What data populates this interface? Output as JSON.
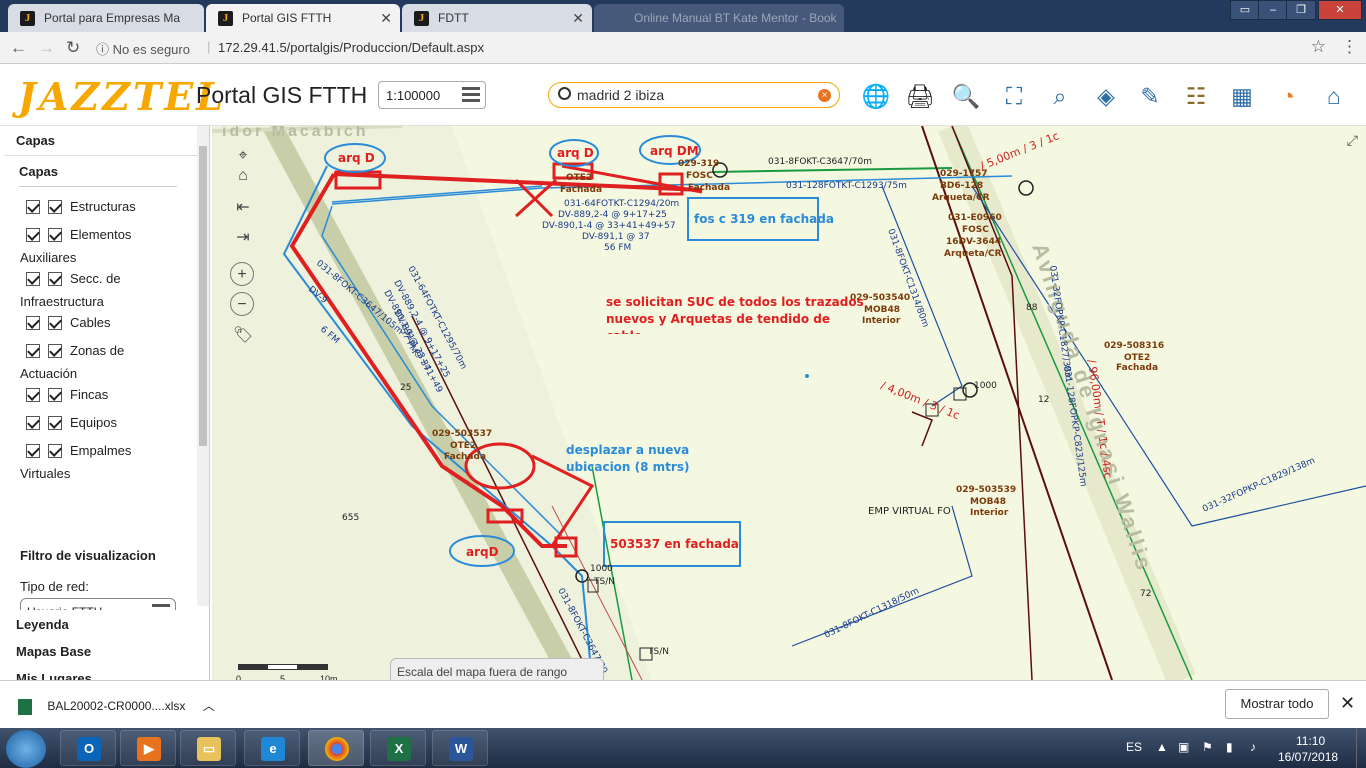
{
  "browser": {
    "tabs": [
      {
        "title": "Portal para Empresas Ma",
        "favicon": "J"
      },
      {
        "title": "Portal GIS FTTH",
        "favicon": "J"
      },
      {
        "title": "FDTT",
        "favicon": "J"
      },
      {
        "title": "Online Manual BT Kate Mentor - Book",
        "favicon": ""
      }
    ],
    "security": "No es seguro",
    "url": "172.29.41.5/portalgis/Produccion/Default.aspx"
  },
  "header": {
    "logo_text": "JAZZTEL",
    "title": "Portal GIS FTTH",
    "scale": "1:100000",
    "search_value": "madrid 2 ibiza",
    "tool_icons": [
      "globe-icon",
      "printer-icon",
      "magnifier-icon",
      "measure-icon",
      "route-search-icon",
      "layers-query-icon",
      "edit-icon",
      "legend-icon",
      "grid-icon",
      "wifi-icon",
      "home-icon"
    ]
  },
  "panel": {
    "layers_header": "Capas",
    "layers_sub": "Capas",
    "layers": [
      {
        "label": "Estructuras",
        "cont": ""
      },
      {
        "label": "Elementos",
        "cont": "Auxiliares"
      },
      {
        "label": "Secc. de",
        "cont": "Infraestructura"
      },
      {
        "label": "Cables",
        "cont": ""
      },
      {
        "label": "Zonas de",
        "cont": "Actuación"
      },
      {
        "label": "Fincas",
        "cont": ""
      },
      {
        "label": "Equipos",
        "cont": ""
      },
      {
        "label": "Empalmes",
        "cont": "Virtuales"
      }
    ],
    "filter_title": "Filtro de visualizacion",
    "net_type_label": "Tipo de red:",
    "net_type_value": "Usuario FTTH",
    "sections": [
      "Leyenda",
      "Mapas Base",
      "Mis Lugares"
    ]
  },
  "map": {
    "scale_note": "Escala del mapa fuera de rango",
    "scalebar_ticks": [
      "0",
      "5",
      "10m"
    ],
    "street_label": "idor Macabich",
    "avenue_label": "Avinguda de Ignasi Wallis",
    "annotations": {
      "arq_d_1": "arq D",
      "arq_d_2": "arq D",
      "arq_dm": "arq DM",
      "arq_d_3": "arqD",
      "fos_c": "fos c 319 en fachada",
      "suc": "se solicitan SUC de todos los trazados nuevos y Arquetas de tendido de cable",
      "desplazar": "desplazar a nueva ubicacion (8 mtrs)",
      "fachada_503537": "503537 en fachada"
    },
    "labels": {
      "cable_top": "031-8FOKT-C3647/70m",
      "cable_128": "031-128FOTKT-C1293/75m",
      "cable_64": "031-64FOTKT-C1294/20m",
      "dv889": "DV-889,2-4 @ 9+17+25",
      "dv890": "DV-890,1-4 @ 33+41+49+57",
      "dv891": "DV-891,1 @ 37",
      "fm56": "56 FM",
      "otc": "OTE2",
      "fachada_a": "Fachada",
      "n029_319": "029-319",
      "fosc": "FOSC",
      "fachada_b": "Fachada",
      "n029_1757": "029-1757",
      "bd6": "BD6-128",
      "arqueta_cr1": "Arqueta/CR",
      "n031_e0960": "031-E0960",
      "fosc2": "FOSC",
      "dv3644": "16DV-3644",
      "arqueta_cr2": "Arqueta/CR",
      "len5": "/ 5,00m / 3 / 1c",
      "cable_3135": "031-8FOKT-C1314/80m",
      "n029_503540": "029-503540",
      "mob48": "MOB48",
      "interior": "Interior",
      "n88": "88",
      "cable_32pkp": "031-32FOPKP-C1827/38m",
      "n029_508316": "029-508316",
      "ote2": "OTE2",
      "fachada_c": "Fachada",
      "len4": "/ 4,00m / 3 / 1c",
      "n1000": "1000",
      "n12": "12",
      "cable_128pkp": "031-128FOPKP-C823/125m",
      "len96": "/ 96,00m / T / 1c / 4sc",
      "cable_1829": "031-32FOPKP-C1829/138m",
      "n029_503539": "029-503539",
      "mob48b": "MOB48",
      "interior_b": "Interior",
      "emp_virtual": "EMP VIRTUAL FO",
      "n655": "655",
      "n25": "25",
      "n029_503537": "029-503537",
      "ote2b": "OTE2",
      "fachada_d": "Fachada",
      "n1000b": "1000",
      "tsn1": "TS/N",
      "tsn2": "TS/N",
      "cable_1318": "031-8FOKT-C1318/50m",
      "n72": "72",
      "cable_3647b": "031-8FOKT-C3647/30",
      "cable_1295": "031-64FOTKT-C1295/70m",
      "dv889b": "DV-889,2-4 @ 9+17+25",
      "dv890b": "DV-890,1-3 @ 33+41+49",
      "dv891b": "DV-891,1 @ 37",
      "fm57": "57 FM",
      "cable_105": "031-8FOKT-C3647/105m",
      "dv6": "DV-9",
      "fm6": "6 FM"
    }
  },
  "downloads": {
    "file": "BAL20002-CR0000....xlsx",
    "show_all": "Mostrar todo"
  },
  "taskbar": {
    "lang": "ES",
    "time": "11:10",
    "date": "16/07/2018"
  }
}
